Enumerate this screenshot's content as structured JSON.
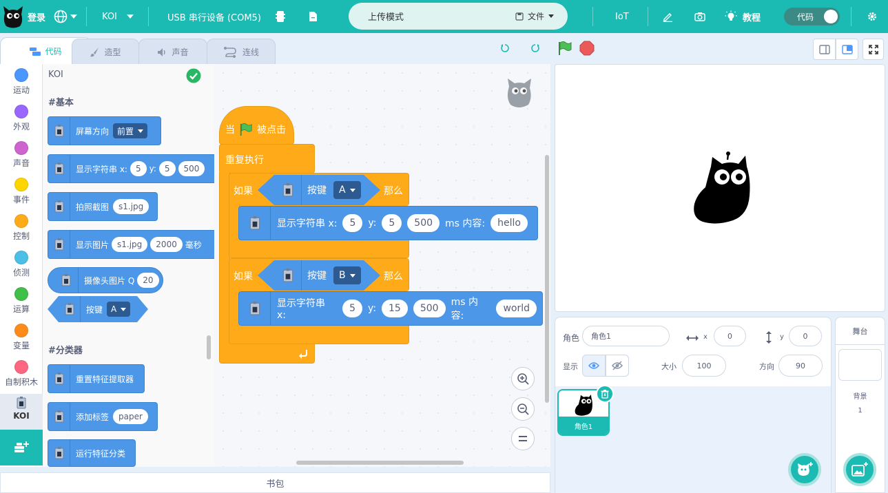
{
  "topbar": {
    "login": "登录",
    "device": "KOI",
    "port": "USB 串行设备 (COM5)",
    "upload_mode": "上传模式",
    "file_menu": "文件",
    "iot": "IoT",
    "tutorial": "教程",
    "code_toggle": "代码"
  },
  "tabs": {
    "code": "代码",
    "costume": "造型",
    "sound": "声音",
    "connect": "连线"
  },
  "categories": {
    "motion": "运动",
    "looks": "外观",
    "sound": "声音",
    "events": "事件",
    "control": "控制",
    "sensing": "侦测",
    "operators": "运算",
    "variables": "变量",
    "myblocks": "自制积木",
    "koi": "KOI"
  },
  "palette": {
    "ext_title": "KOI",
    "basic_header": "#基本",
    "screen_dir": "屏幕方向",
    "screen_dir_val": "前置",
    "show_string": "显示字符串 x:",
    "ss_x": "5",
    "ss_y_label": "y:",
    "ss_y": "5",
    "ss_ms": "500",
    "snapshot": "拍照截图",
    "snapshot_val": "s1.jpg",
    "show_image": "显示图片",
    "si_file": "s1.jpg",
    "si_ms": "2000",
    "si_unit": "毫秒",
    "camera_image": "摄像头图片 Q",
    "camera_val": "20",
    "button": "按键",
    "button_val": "A",
    "classifier_header": "#分类器",
    "reset_feature": "重置特征提取器",
    "add_tag": "添加标签",
    "tag_val": "paper",
    "run_classifier": "运行特征分类"
  },
  "script": {
    "hat_when": "当",
    "hat_clicked": "被点击",
    "forever": "重复执行",
    "if": "如果",
    "then": "那么",
    "button": "按键",
    "if1_key": "A",
    "if2_key": "B",
    "show_string": "显示字符串 x:",
    "y_label": "y:",
    "ms_label": "ms 内容:",
    "s1_x": "5",
    "s1_y": "5",
    "s1_ms": "500",
    "s1_text": "hello",
    "s2_x": "5",
    "s2_y": "15",
    "s2_ms": "500",
    "s2_text": "world"
  },
  "backpack": "书包",
  "sprite_info": {
    "sprite_label": "角色",
    "sprite_name": "角色1",
    "x_label": "x",
    "x": "0",
    "y_label": "y",
    "y": "0",
    "show_label": "显示",
    "size_label": "大小",
    "size": "100",
    "direction_label": "方向",
    "direction": "90"
  },
  "sprite_list": [
    {
      "name": "角色1"
    }
  ],
  "stage_panel": {
    "title": "舞台",
    "backdrops_label": "背景",
    "backdrops_count": "1"
  },
  "colors": {
    "accent": "#1bbbb4",
    "motion": "#4c97ff",
    "events": "#ffbf00",
    "control": "#ffab19"
  }
}
